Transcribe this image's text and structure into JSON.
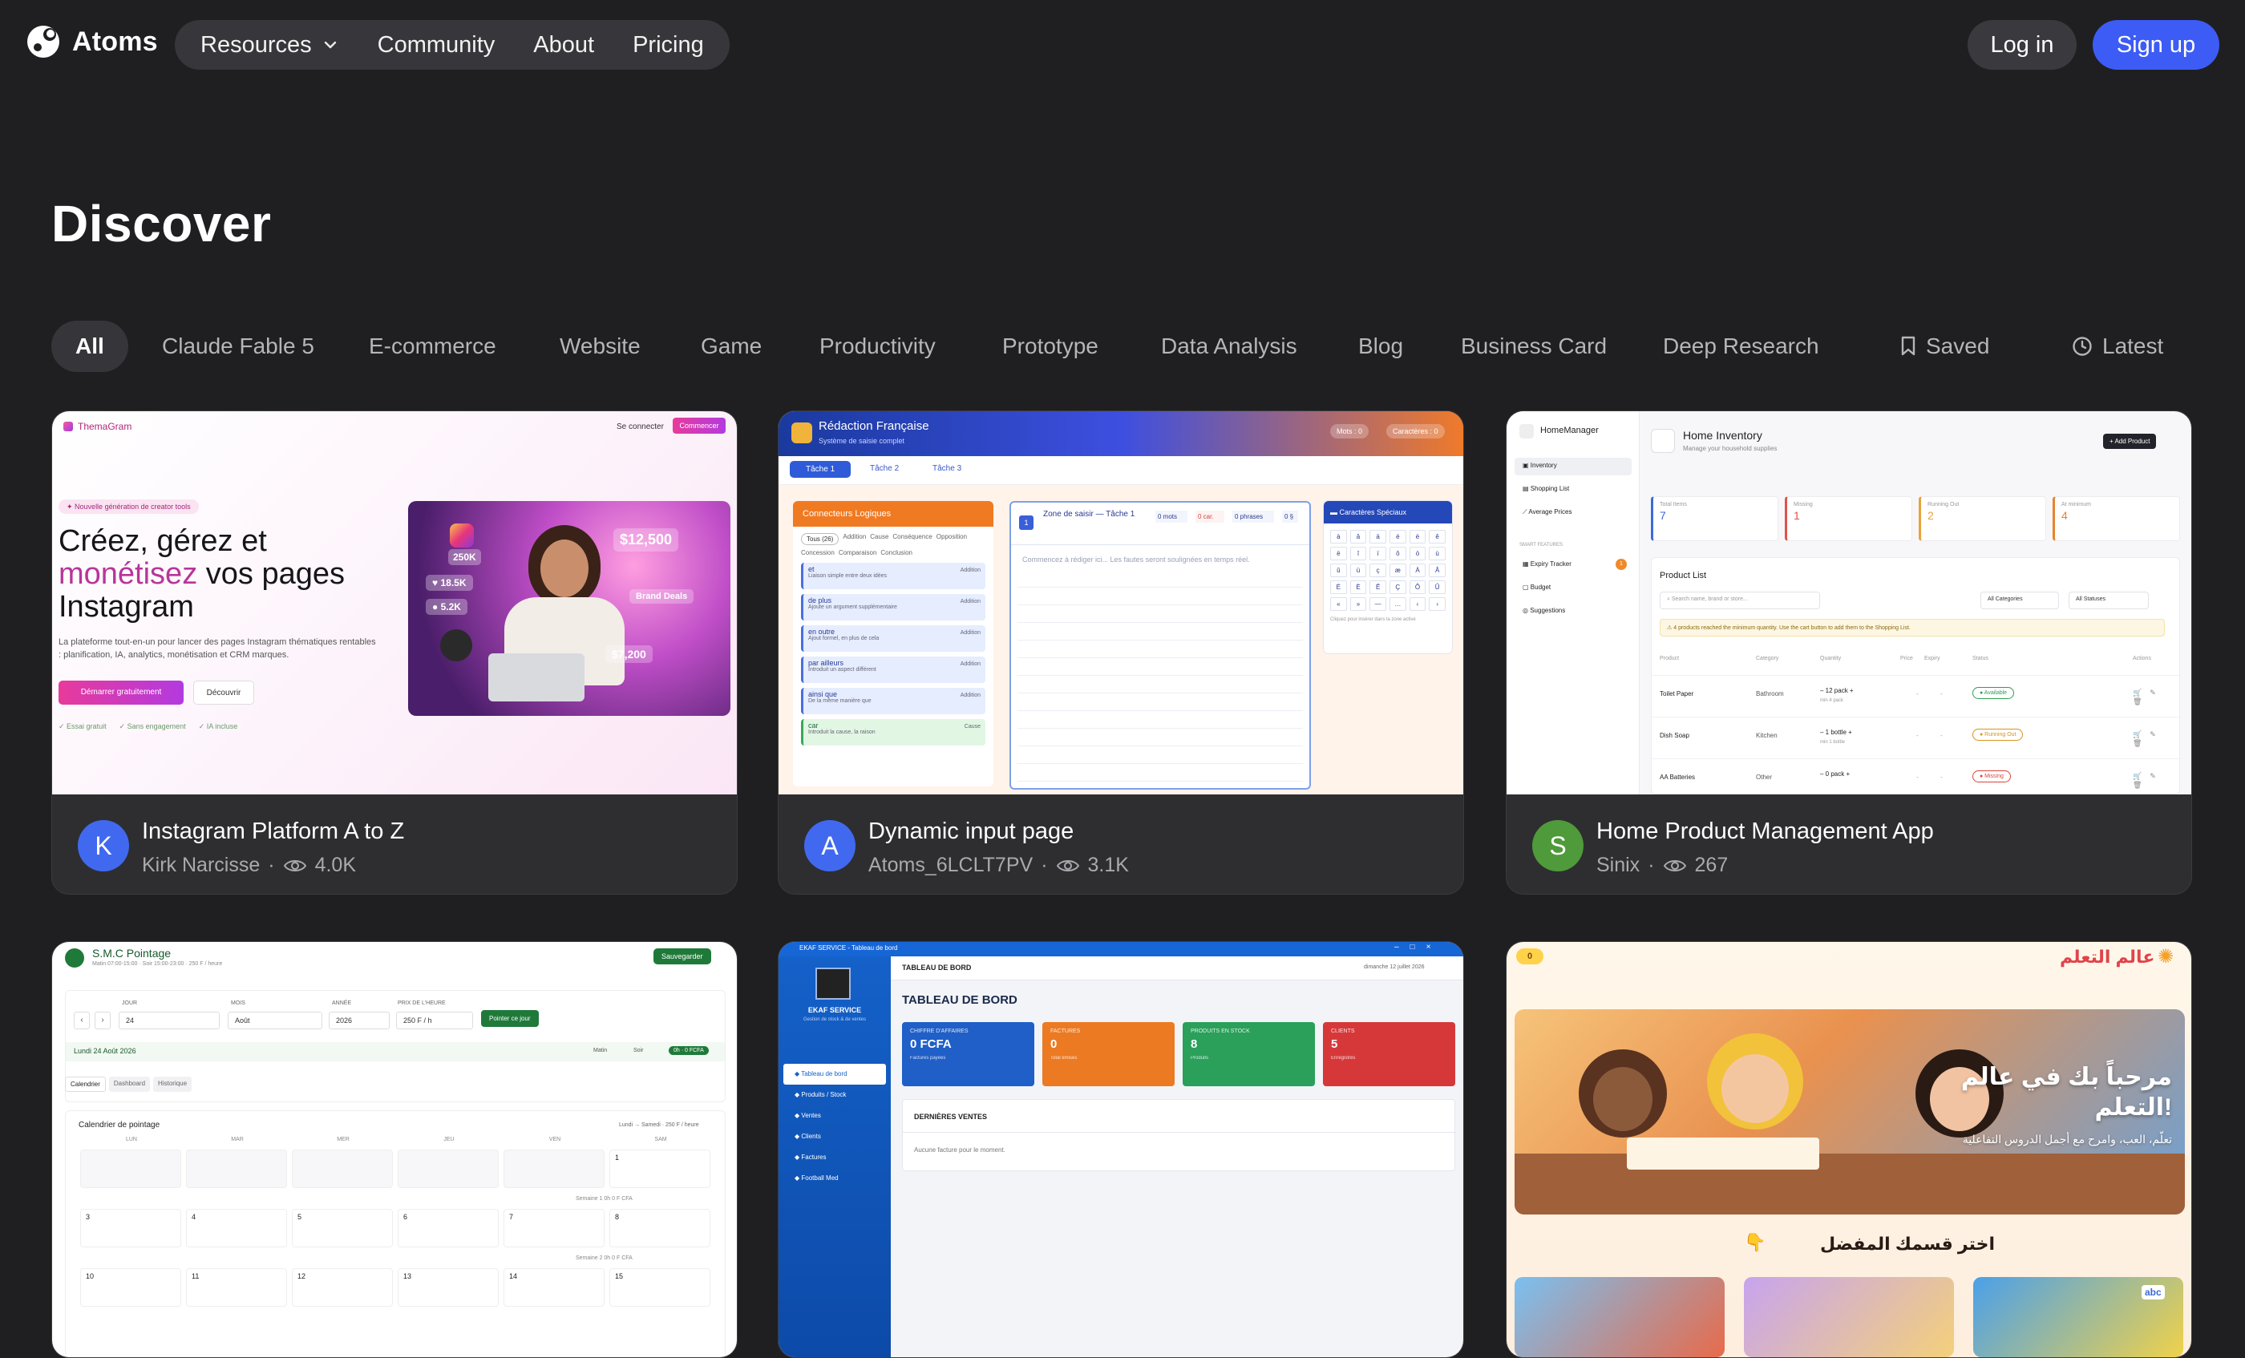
{
  "header": {
    "brand": "Atoms",
    "nav": [
      {
        "label": "Resources",
        "has_dropdown": true
      },
      {
        "label": "Community"
      },
      {
        "label": "About"
      },
      {
        "label": "Pricing"
      }
    ],
    "login_label": "Log in",
    "signup_label": "Sign up",
    "accent_color": "#3d5cf5"
  },
  "page": {
    "title": "Discover"
  },
  "filters": {
    "items": [
      "All",
      "Claude Fable 5",
      "E-commerce",
      "Website",
      "Game",
      "Productivity",
      "Prototype",
      "Data Analysis",
      "Blog",
      "Business Card",
      "Deep Research"
    ],
    "active": "All",
    "saved_label": "Saved",
    "latest_label": "Latest"
  },
  "cards": [
    {
      "title": "Instagram Platform A to Z",
      "author": "Kirk Narcisse",
      "views": "4.0K",
      "avatar_letter": "K",
      "avatar_color": "#4169f0",
      "preview": {
        "brand": "ThemaGram",
        "login": "Se connecter",
        "cta": "Commencer",
        "badge": "Nouvelle génération de creator tools",
        "headline_1": "Créez, gérez et",
        "headline_accent": "monétisez",
        "headline_2": "vos pages",
        "headline_3": "Instagram",
        "sub": "La plateforme tout-en-un pour lancer des pages Instagram thématiques rentables : planification, IA, analytics, monétisation et CRM marques.",
        "primary_btn": "Démarrer gratuitement",
        "secondary_btn": "Découvrir",
        "checks": [
          "Essai gratuit",
          "Sans engagement",
          "IA incluse"
        ],
        "stat_followers": "250K",
        "stat_likes": "18.5K",
        "stat_comments": "5.2K",
        "stat_money": "$12,500",
        "stat_deals": "Brand Deals",
        "stat_money2": "$7,200"
      }
    },
    {
      "title": "Dynamic input page",
      "author": "Atoms_6LCLT7PV",
      "views": "3.1K",
      "avatar_letter": "A",
      "avatar_color": "#4169f0",
      "preview": {
        "app_title": "Rédaction Française",
        "app_sub": "Système de saisie complet",
        "chip_mots": "Mots : 0",
        "chip_car": "Caractères : 0",
        "tabs": [
          "Tâche 1",
          "Tâche 2",
          "Tâche 3"
        ],
        "left_panel": "Connecteurs Logiques",
        "filters": [
          "Tous (26)",
          "Addition",
          "Cause",
          "Conséquence",
          "Opposition",
          "Concession",
          "Comparaison",
          "Conclusion"
        ],
        "connectors": [
          {
            "word": "et",
            "desc": "Liaison simple entre deux idées",
            "tag": "Addition"
          },
          {
            "word": "de plus",
            "desc": "Ajoute un argument supplémentaire",
            "tag": "Addition"
          },
          {
            "word": "en outre",
            "desc": "Ajout formel, en plus de cela",
            "tag": "Addition"
          },
          {
            "word": "par ailleurs",
            "desc": "Introduit un aspect différent",
            "tag": "Addition"
          },
          {
            "word": "ainsi que",
            "desc": "De la même manière que",
            "tag": "Addition"
          },
          {
            "word": "car",
            "desc": "Introduit la cause, la raison",
            "tag": "Cause"
          }
        ],
        "zone_title": "Zone de saisir — Tâche 1",
        "zone_stats": [
          "0 mots",
          "0 car.",
          "0 phrases",
          "0 §"
        ],
        "zone_placeholder": "Commencez à rédiger ici... Les fautes seront soulignées en temps réel.",
        "right_panel": "Caractères Spéciaux",
        "chars": [
          "à",
          "â",
          "ä",
          "é",
          "è",
          "ê",
          "ë",
          "î",
          "ï",
          "ô",
          "ö",
          "ù",
          "û",
          "ü",
          "ç",
          "æ",
          "À",
          "Â",
          "É",
          "È",
          "Ê",
          "Ç",
          "Ô",
          "Û",
          "«",
          "»",
          "—",
          "…",
          "‹",
          "›"
        ],
        "right_hint": "Cliquez pour insérer dans la zone active"
      }
    },
    {
      "title": "Home Product Management App",
      "author": "Sinix",
      "views": "267",
      "avatar_letter": "S",
      "avatar_color": "#4f9a3a",
      "preview": {
        "brand": "HomeManager",
        "nav": [
          "Inventory",
          "Shopping List",
          "Average Prices"
        ],
        "section": "SMART FEATURES",
        "smart": [
          "Expiry Tracker",
          "Budget",
          "Suggestions"
        ],
        "expiry_badge": "1",
        "page_title": "Home Inventory",
        "page_sub": "Manage your household supplies",
        "add_btn": "+ Add Product",
        "stats": [
          {
            "label": "Total Items",
            "value": "7",
            "color": "#3b6bd6"
          },
          {
            "label": "Missing",
            "value": "1",
            "color": "#e0524a"
          },
          {
            "label": "Running Out",
            "value": "2",
            "color": "#e8a33a"
          },
          {
            "label": "At minimum",
            "value": "4",
            "color": "#e8842a"
          }
        ],
        "list_title": "Product List",
        "search_placeholder": "Search name, brand or store...",
        "cat_filter": "All Categories",
        "status_filter": "All Statuses",
        "warning": "4 products reached the minimum quantity. Use the cart button to add them to the Shopping List.",
        "columns": [
          "Product",
          "Category",
          "Quantity",
          "Price",
          "Expiry",
          "Status",
          "Actions"
        ],
        "rows": [
          {
            "product": "Toilet Paper",
            "category": "Bathroom",
            "qty": "12 pack",
            "min": "min 4 pack",
            "status": "Available",
            "status_color": "#2f9e55"
          },
          {
            "product": "Dish Soap",
            "category": "Kitchen",
            "qty": "1 bottle",
            "min": "min 1 bottle",
            "status": "Running Out",
            "status_color": "#d9921d"
          },
          {
            "product": "AA Batteries",
            "category": "Other",
            "qty": "0 pack",
            "min": "",
            "status": "Missing",
            "status_color": "#d9443a"
          }
        ]
      }
    },
    {
      "preview": {
        "brand": "S.M.C Pointage",
        "brand_sub": "Matin 07:00-15:00 · Soir 15:00-23:00 · 250 F / heure",
        "save_btn": "Sauvegarder",
        "labels": [
          "JOUR",
          "MOIS",
          "ANNÉE",
          "PRIX DE L'HEURE"
        ],
        "values": [
          "24",
          "Août",
          "2026",
          "250 F / h"
        ],
        "point_btn": "Pointer ce jour",
        "date_line": "Lundi 24 Août 2026",
        "shift_a": "Matin",
        "shift_b": "Soir",
        "badge": "0h · 0 FCFA",
        "tabs": [
          "Calendrier",
          "Dashboard",
          "Historique"
        ],
        "cal_title": "Calendrier de pointage",
        "cal_sub": "Lundi → Samedi · 250 F / heure",
        "days": [
          "LUN",
          "MAR",
          "MER",
          "JEU",
          "VEN",
          "SAM"
        ],
        "week1_label": "Semaine 1",
        "week2_label": "Semaine 2",
        "week_total": "0h",
        "week_money": "0 F CFA",
        "row1": [
          "",
          "",
          "",
          "",
          "",
          "1"
        ],
        "row2": [
          "3",
          "4",
          "5",
          "6",
          "7",
          "8"
        ],
        "row3": [
          "10",
          "11",
          "12",
          "13",
          "14",
          "15"
        ]
      }
    },
    {
      "preview": {
        "window_title": "EKAF SERVICE - Tableau de bord",
        "brand": "EKAF SERVICE",
        "brand_sub": "Gestion de stock & de ventes",
        "nav": [
          "Tableau de bord",
          "Produits / Stock",
          "Ventes",
          "Clients",
          "Factures",
          "Football Med"
        ],
        "topbar": "TABLEAU DE BORD",
        "date": "dimanche 12 juillet 2026",
        "heading": "TABLEAU DE BORD",
        "stats": [
          {
            "label": "CHIFFRE D'AFFAIRES",
            "value": "0 FCFA",
            "sub": "Factures payées",
            "color": "#1f5fc7"
          },
          {
            "label": "FACTURES",
            "value": "0",
            "sub": "Total émises",
            "color": "#ec7a22"
          },
          {
            "label": "PRODUITS EN STOCK",
            "value": "8",
            "sub": "Produits",
            "color": "#2aa05a"
          },
          {
            "label": "CLIENTS",
            "value": "5",
            "sub": "Enregistrés",
            "color": "#d6383a"
          }
        ],
        "sales_title": "DERNIÈRES VENTES",
        "sales_empty": "Aucune facture pour le moment."
      }
    },
    {
      "preview": {
        "brand": "عالم التعلم",
        "coins": "0",
        "hero_title": "مرحباً بك في عالم التعلم!",
        "hero_sub": "تعلّم، العب، وامرح مع أجمل الدروس التفاعلية",
        "section": "اختر قسمك المفضل",
        "tile_text": "abc"
      }
    }
  ]
}
